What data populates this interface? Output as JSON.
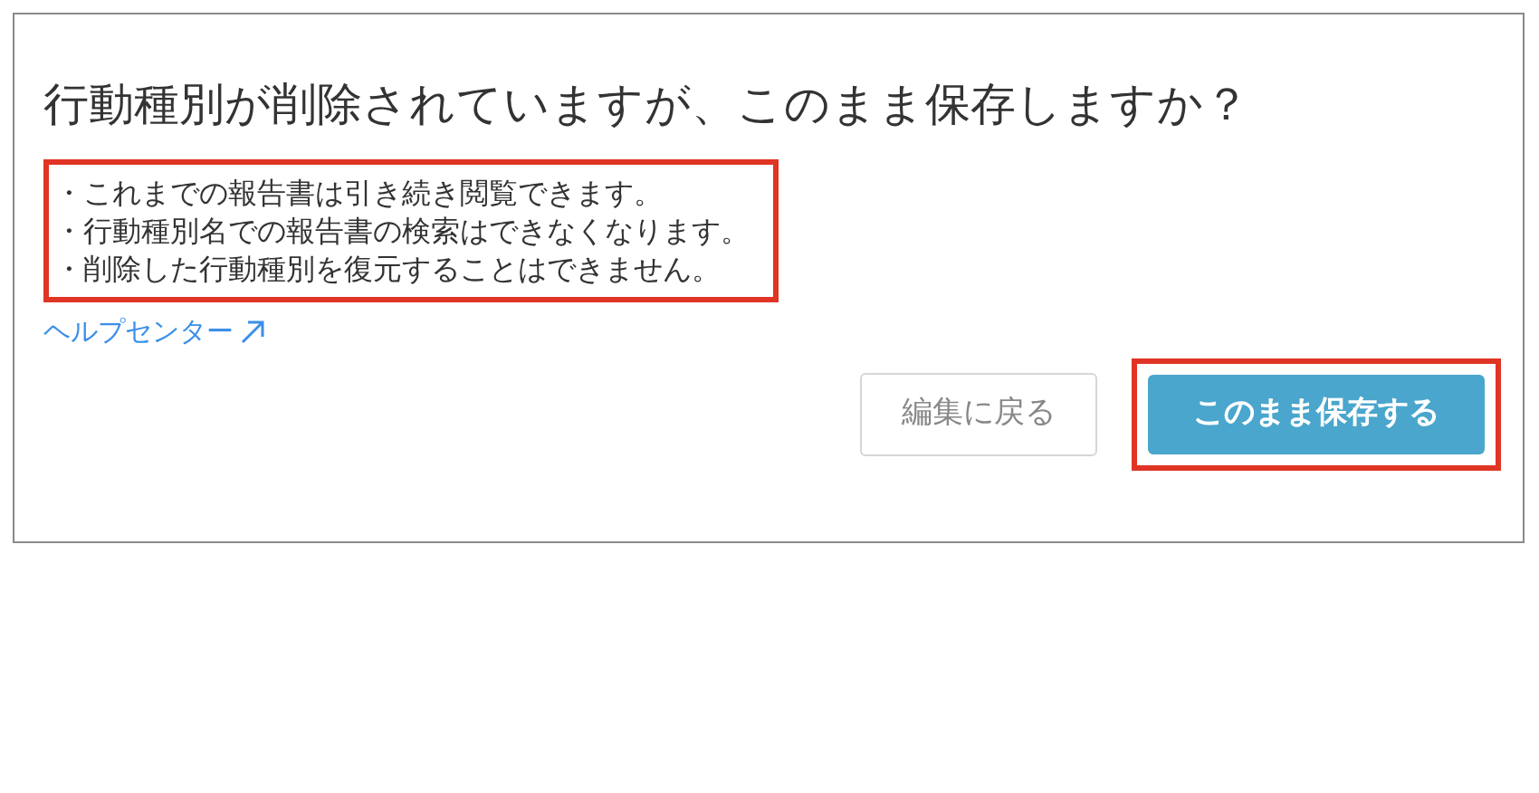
{
  "dialog": {
    "title": "行動種別が削除されていますが、このまま保存しますか？",
    "notes": {
      "highlighted": true,
      "items": [
        "・これまでの報告書は引き続き閲覧できます。",
        "・行動種別名での報告書の検索はできなくなります。",
        "・削除した行動種別を復元することはできません。"
      ]
    },
    "help_link": "ヘルプセンター",
    "buttons": [
      {
        "kind": "secondary",
        "label": "編集に戻る",
        "highlighted": false
      },
      {
        "kind": "primary",
        "label": "このまま保存する",
        "highlighted": true
      }
    ]
  }
}
